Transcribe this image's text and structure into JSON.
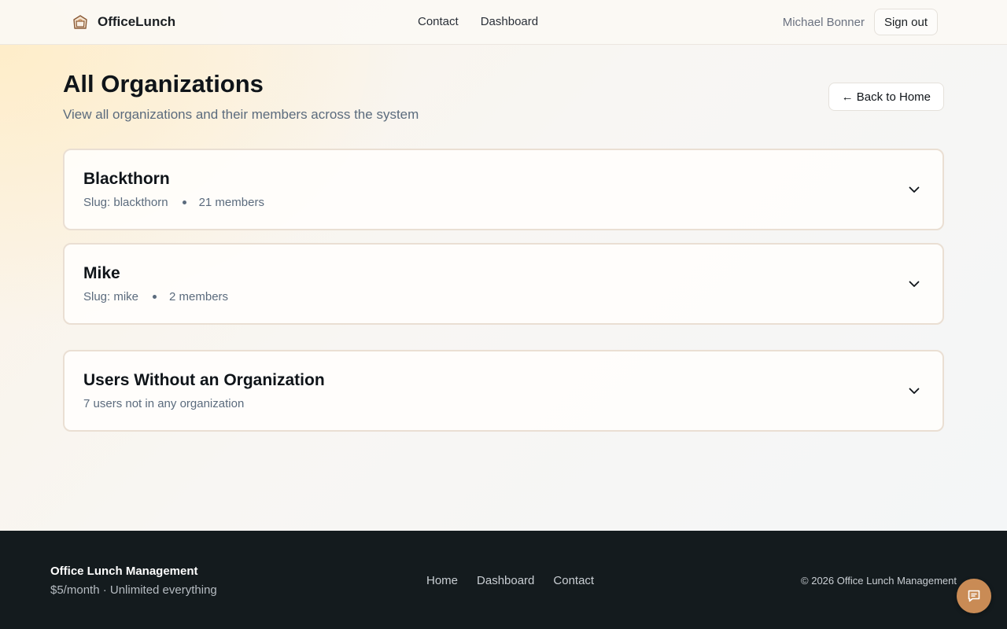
{
  "header": {
    "app_name": "OfficeLunch",
    "nav": [
      {
        "label": "Contact"
      },
      {
        "label": "Dashboard"
      }
    ],
    "user_name": "Michael Bonner",
    "sign_out_label": "Sign out"
  },
  "page": {
    "title": "All Organizations",
    "subtitle": "View all organizations and their members across the system",
    "back_label": "← Back to Home"
  },
  "organizations": [
    {
      "name": "Blackthorn",
      "slug": "Slug: blackthorn",
      "members": "21 members"
    },
    {
      "name": "Mike",
      "slug": "Slug: mike",
      "members": "2 members"
    }
  ],
  "no_org": {
    "title": "Users Without an Organization",
    "count_text": "7 users not in any organization"
  },
  "footer": {
    "title": "Office Lunch Management",
    "tagline": "$5/month · Unlimited everything",
    "nav": [
      {
        "label": "Home"
      },
      {
        "label": "Dashboard"
      },
      {
        "label": "Contact"
      }
    ],
    "copyright": "© 2026 Office Lunch Management"
  },
  "colors": {
    "accent": "#c98b55",
    "footer_bg": "#141b1e",
    "card_border": "#eadfd3"
  }
}
